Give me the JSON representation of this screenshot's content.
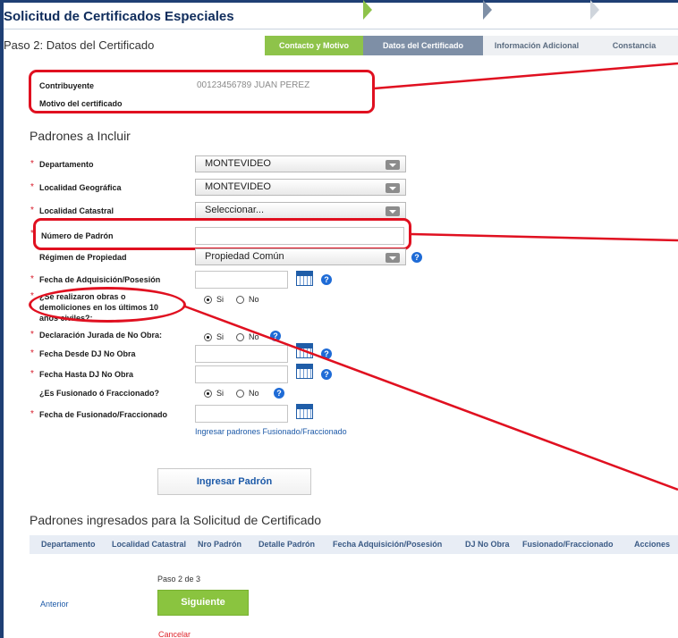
{
  "page": {
    "title": "Solicitud de Certificados Especiales",
    "step_title": "Paso 2: Datos del Certificado"
  },
  "wizard": {
    "steps": [
      "Contacto y Motivo",
      "Datos del Certificado",
      "Información Adicional",
      "Constancia"
    ],
    "current_index": 1
  },
  "info": {
    "contribuyente_label": "Contribuyente",
    "contribuyente_value": "00123456789 JUAN PEREZ",
    "motivo_label": "Motivo del certificado"
  },
  "padrones_section": {
    "heading": "Padrones a Incluir",
    "departamento": {
      "label": "Departamento",
      "value": "MONTEVIDEO"
    },
    "localidad_geografica": {
      "label": "Localidad Geográfica",
      "value": "MONTEVIDEO"
    },
    "localidad_catastral": {
      "label": "Localidad Catastral",
      "value": "Seleccionar..."
    },
    "numero_padron": {
      "label": "Número de Padrón",
      "value": ""
    },
    "regimen": {
      "label": "Régimen de Propiedad",
      "value": "Propiedad Común"
    },
    "fecha_adquisicion": {
      "label": "Fecha de Adquisición/Posesión",
      "value": ""
    },
    "obras": {
      "label_lines": [
        "¿Se realizaron obras o",
        "demoliciones en los últimos 10",
        "años civiles?:"
      ],
      "options": [
        "Si",
        "No"
      ],
      "selected": "Si"
    },
    "declaracion": {
      "label": "Declaración Jurada de No Obra:",
      "options": [
        "Si",
        "No"
      ],
      "selected": "Si"
    },
    "fecha_desde": {
      "label": "Fecha Desde DJ No Obra",
      "value": ""
    },
    "fecha_hasta": {
      "label": "Fecha Hasta DJ No Obra",
      "value": ""
    },
    "fusionado": {
      "label": "¿Es Fusionado ó Fraccionado?",
      "options": [
        "Si",
        "No"
      ],
      "selected": "Si"
    },
    "fecha_fusionado": {
      "label": "Fecha de Fusionado/Fraccionado",
      "value": ""
    },
    "fusionados_link": "Ingresar padrones Fusionado/Fraccionado",
    "help_glyph": "?",
    "required_mark": "*",
    "add_button": "Ingresar Padrón"
  },
  "ingresados": {
    "heading": "Padrones ingresados para la Solicitud de Certificado",
    "columns": [
      "Departamento",
      "Localidad Catastral",
      "Nro Padrón",
      "Detalle Padrón",
      "Fecha Adquisición/Posesión",
      "DJ No Obra",
      "Fusionado/Fraccionado",
      "Acciones"
    ]
  },
  "navigation": {
    "step_counter": "Paso 2 de 3",
    "previous": "Anterior",
    "next": "Siguiente",
    "cancel": "Cancelar"
  },
  "colors": {
    "annotation_red": "#e01020",
    "step_done": "#8ec34a",
    "step_active": "#7e8fa6",
    "title_blue": "#0f2c5c",
    "link_blue": "#1d5aa8",
    "help_blue": "#1e6bd6"
  }
}
